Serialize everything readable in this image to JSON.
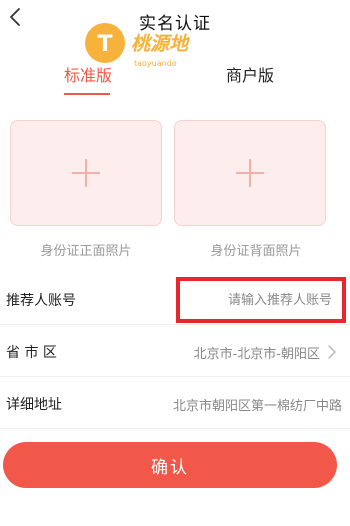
{
  "header": {
    "title": "实名认证",
    "back_icon": "chevron-left-icon"
  },
  "watermark": {
    "logo_letter": "T",
    "logo_text": "桃源地",
    "logo_subtext": "taoyuando"
  },
  "tabs": [
    {
      "label": "标准版",
      "active": true
    },
    {
      "label": "商户版",
      "active": false
    }
  ],
  "uploads": {
    "front": {
      "caption": "身份证正面照片",
      "icon": "plus-icon"
    },
    "back": {
      "caption": "身份证背面照片",
      "icon": "plus-icon"
    }
  },
  "form": {
    "referrer": {
      "label": "推荐人账号",
      "placeholder": "请输入推荐人账号",
      "value": ""
    },
    "region": {
      "label": "省 市 区",
      "value": "北京市-北京市-朝阳区",
      "icon": "chevron-right-icon"
    },
    "address": {
      "label": "详细地址",
      "value": "北京市朝阳区第一棉纺厂中路"
    }
  },
  "confirm": {
    "label": "确认"
  },
  "colors": {
    "accent": "#f1584a",
    "highlight_border": "#e8262d",
    "upload_bg": "#fdeeed",
    "logo_badge": "#f7b23b"
  }
}
